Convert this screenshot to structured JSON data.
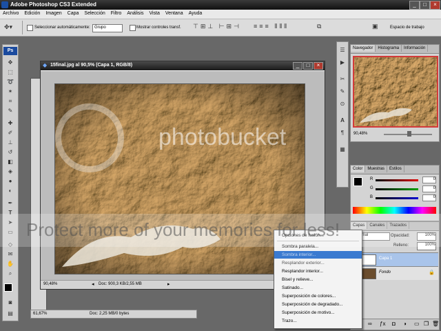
{
  "app": {
    "title": "Adobe Photoshop CS3 Extended",
    "window_controls": {
      "minimize": "_",
      "maximize": "□",
      "close": "×"
    }
  },
  "menu": [
    "Archivo",
    "Edición",
    "Imagen",
    "Capa",
    "Selección",
    "Filtro",
    "Análisis",
    "Vista",
    "Ventana",
    "Ayuda"
  ],
  "options_bar": {
    "auto_select_label": "Seleccionar automáticamente:",
    "auto_select_value": "Grupo",
    "transform_label": "Mostrar controles transf.",
    "workspace_label": "Espacio de trabajo"
  },
  "tools": {
    "logo": "Ps"
  },
  "document": {
    "title": "15final.jpg al 90,5% (Capa 1, RGB/8)",
    "zoom": "90,48%",
    "doc_info": "Doc: 900,3 KB/2,55 MB",
    "outer_zoom": "61,67%",
    "outer_info": "Doc: 2,25 MB/0 bytes"
  },
  "navigator": {
    "tabs": [
      "Navegador",
      "Histograma",
      "Información"
    ],
    "zoom": "90,48%"
  },
  "color": {
    "tabs": [
      "Color",
      "Muestras",
      "Estilos"
    ],
    "channels": [
      {
        "label": "R",
        "value": "0",
        "color": "#e00000"
      },
      {
        "label": "G",
        "value": "0",
        "color": "#00a000"
      },
      {
        "label": "B",
        "value": "0",
        "color": "#0000d0"
      }
    ]
  },
  "layers": {
    "tabs": [
      "Capas",
      "Canales",
      "Trazados"
    ],
    "blend_mode": "Normal",
    "opacity_label": "Opacidad:",
    "opacity": "100%",
    "fill_label": "Relleno:",
    "fill": "100%",
    "items": [
      {
        "name": "Capa 1",
        "selected": true
      },
      {
        "name": "Fondo",
        "selected": false
      }
    ]
  },
  "context_menu": {
    "items": [
      {
        "label": "Opciones de fusión...",
        "state": "normal"
      },
      {
        "label": "Sombra paralela...",
        "state": "normal"
      },
      {
        "label": "Sombra interior...",
        "state": "highlighted"
      },
      {
        "label": "Resplandor exterior...",
        "state": "normal"
      },
      {
        "label": "Resplandor interior...",
        "state": "normal"
      },
      {
        "label": "Bisel y relieve...",
        "state": "normal"
      },
      {
        "label": "Satinado...",
        "state": "normal"
      },
      {
        "label": "Superposición de colores...",
        "state": "normal"
      },
      {
        "label": "Superposición de degradado...",
        "state": "normal"
      },
      {
        "label": "Superposición de motivo...",
        "state": "normal"
      },
      {
        "label": "Trazo...",
        "state": "normal"
      }
    ]
  },
  "watermark": {
    "brand": "photobucket",
    "slogan": "Protect more of your memories for less!"
  }
}
